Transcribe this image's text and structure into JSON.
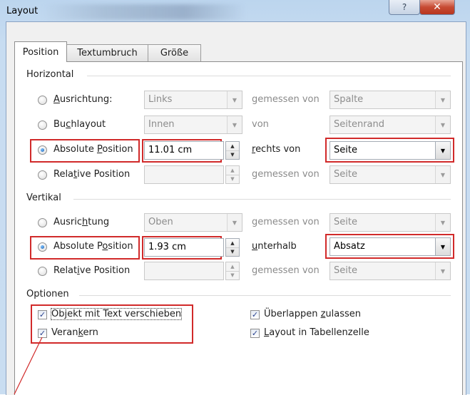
{
  "window": {
    "title": "Layout",
    "help_glyph": "?",
    "close_glyph": "✕"
  },
  "tabs": [
    "Position",
    "Textumbruch",
    "Größe"
  ],
  "horizontal": {
    "heading": "Horizontal",
    "rows": [
      {
        "label_pre": "",
        "label_u": "A",
        "label_post": "usrichtung:",
        "value": "Links",
        "rel_label": "gemessen von",
        "rel_value": "Spalte"
      },
      {
        "label_pre": "Bu",
        "label_u": "c",
        "label_post": "hlayout",
        "value": "Innen",
        "rel_label": "von",
        "rel_value": "Seitenrand"
      },
      {
        "label_pre": "Absolute ",
        "label_u": "P",
        "label_post": "osition",
        "value": "11.01 cm",
        "rel_label_u": "r",
        "rel_label_post": "echts von",
        "rel_value": "Seite"
      },
      {
        "label_pre": "Rela",
        "label_u": "t",
        "label_post": "ive Position",
        "value": "",
        "rel_label": "gemessen von",
        "rel_value": "Seite"
      }
    ]
  },
  "vertikal": {
    "heading": "Vertikal",
    "rows": [
      {
        "label_pre": "Ausric",
        "label_u": "h",
        "label_post": "tung",
        "value": "Oben",
        "rel_label": "gemessen von",
        "rel_value": "Seite"
      },
      {
        "label_pre": "Absolute P",
        "label_u": "o",
        "label_post": "sition",
        "value": "1.93 cm",
        "rel_label_u": "u",
        "rel_label_post": "nterhalb",
        "rel_value": "Absatz"
      },
      {
        "label_pre": "Relat",
        "label_u": "i",
        "label_post": "ve Position",
        "value": "",
        "rel_label": "gemessen von",
        "rel_value": "Seite"
      }
    ]
  },
  "optionen": {
    "heading": "Optionen",
    "checks": [
      {
        "label_pre": "Ob",
        "label_u": "j",
        "label_post": "ekt mit Text verschieben",
        "checked": true
      },
      {
        "label_pre": "Veran",
        "label_u": "k",
        "label_post": "ern",
        "checked": true
      },
      {
        "label_pre": "Überlappen ",
        "label_u": "z",
        "label_post": "ulassen",
        "checked": true
      },
      {
        "label_pre": "",
        "label_u": "L",
        "label_post": "ayout in Tabellenzelle",
        "checked": true
      }
    ]
  },
  "glyphs": {
    "check": "✓",
    "arrow_down": "▼",
    "spin_up": "▲",
    "spin_down": "▼"
  },
  "colors": {
    "highlight_red": "#d12a2a",
    "title_gradient": "#c7dcf1",
    "close_red": "#c74b33"
  }
}
